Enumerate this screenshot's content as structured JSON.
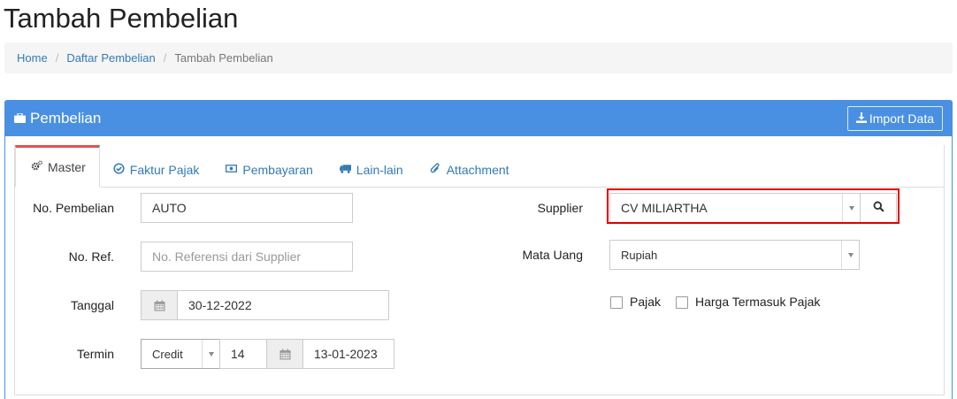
{
  "page": {
    "title": "Tambah Pembelian"
  },
  "breadcrumb": [
    {
      "label": "Home"
    },
    {
      "label": "Daftar Pembelian"
    },
    {
      "label": "Tambah Pembelian"
    }
  ],
  "panel": {
    "title": "Pembelian",
    "import_label": "Import Data"
  },
  "tabs": [
    {
      "label": "Master",
      "icon": "cogs-icon"
    },
    {
      "label": "Faktur Pajak",
      "icon": "check-circle-icon"
    },
    {
      "label": "Pembayaran",
      "icon": "money-icon"
    },
    {
      "label": "Lain-lain",
      "icon": "truck-icon"
    },
    {
      "label": "Attachment",
      "icon": "paperclip-icon"
    }
  ],
  "form": {
    "no_pembelian": {
      "label": "No. Pembelian",
      "value": "AUTO"
    },
    "no_ref": {
      "label": "No. Ref.",
      "placeholder": "No. Referensi dari Supplier"
    },
    "tanggal": {
      "label": "Tanggal",
      "value": "30-12-2022"
    },
    "termin": {
      "label": "Termin",
      "type": "Credit",
      "days": "14",
      "due_date": "13-01-2023"
    },
    "supplier": {
      "label": "Supplier",
      "value": "CV MILIARTHA"
    },
    "mata_uang": {
      "label": "Mata Uang",
      "value": "Rupiah"
    },
    "pajak": {
      "label": "Pajak",
      "checked": false
    },
    "harga_termasuk_pajak": {
      "label": "Harga Termasuk Pajak",
      "checked": false
    }
  },
  "colors": {
    "accent": "#4a90e2",
    "link": "#337ab7",
    "active_tab_border": "#e0534f",
    "highlight": "#e00000"
  }
}
